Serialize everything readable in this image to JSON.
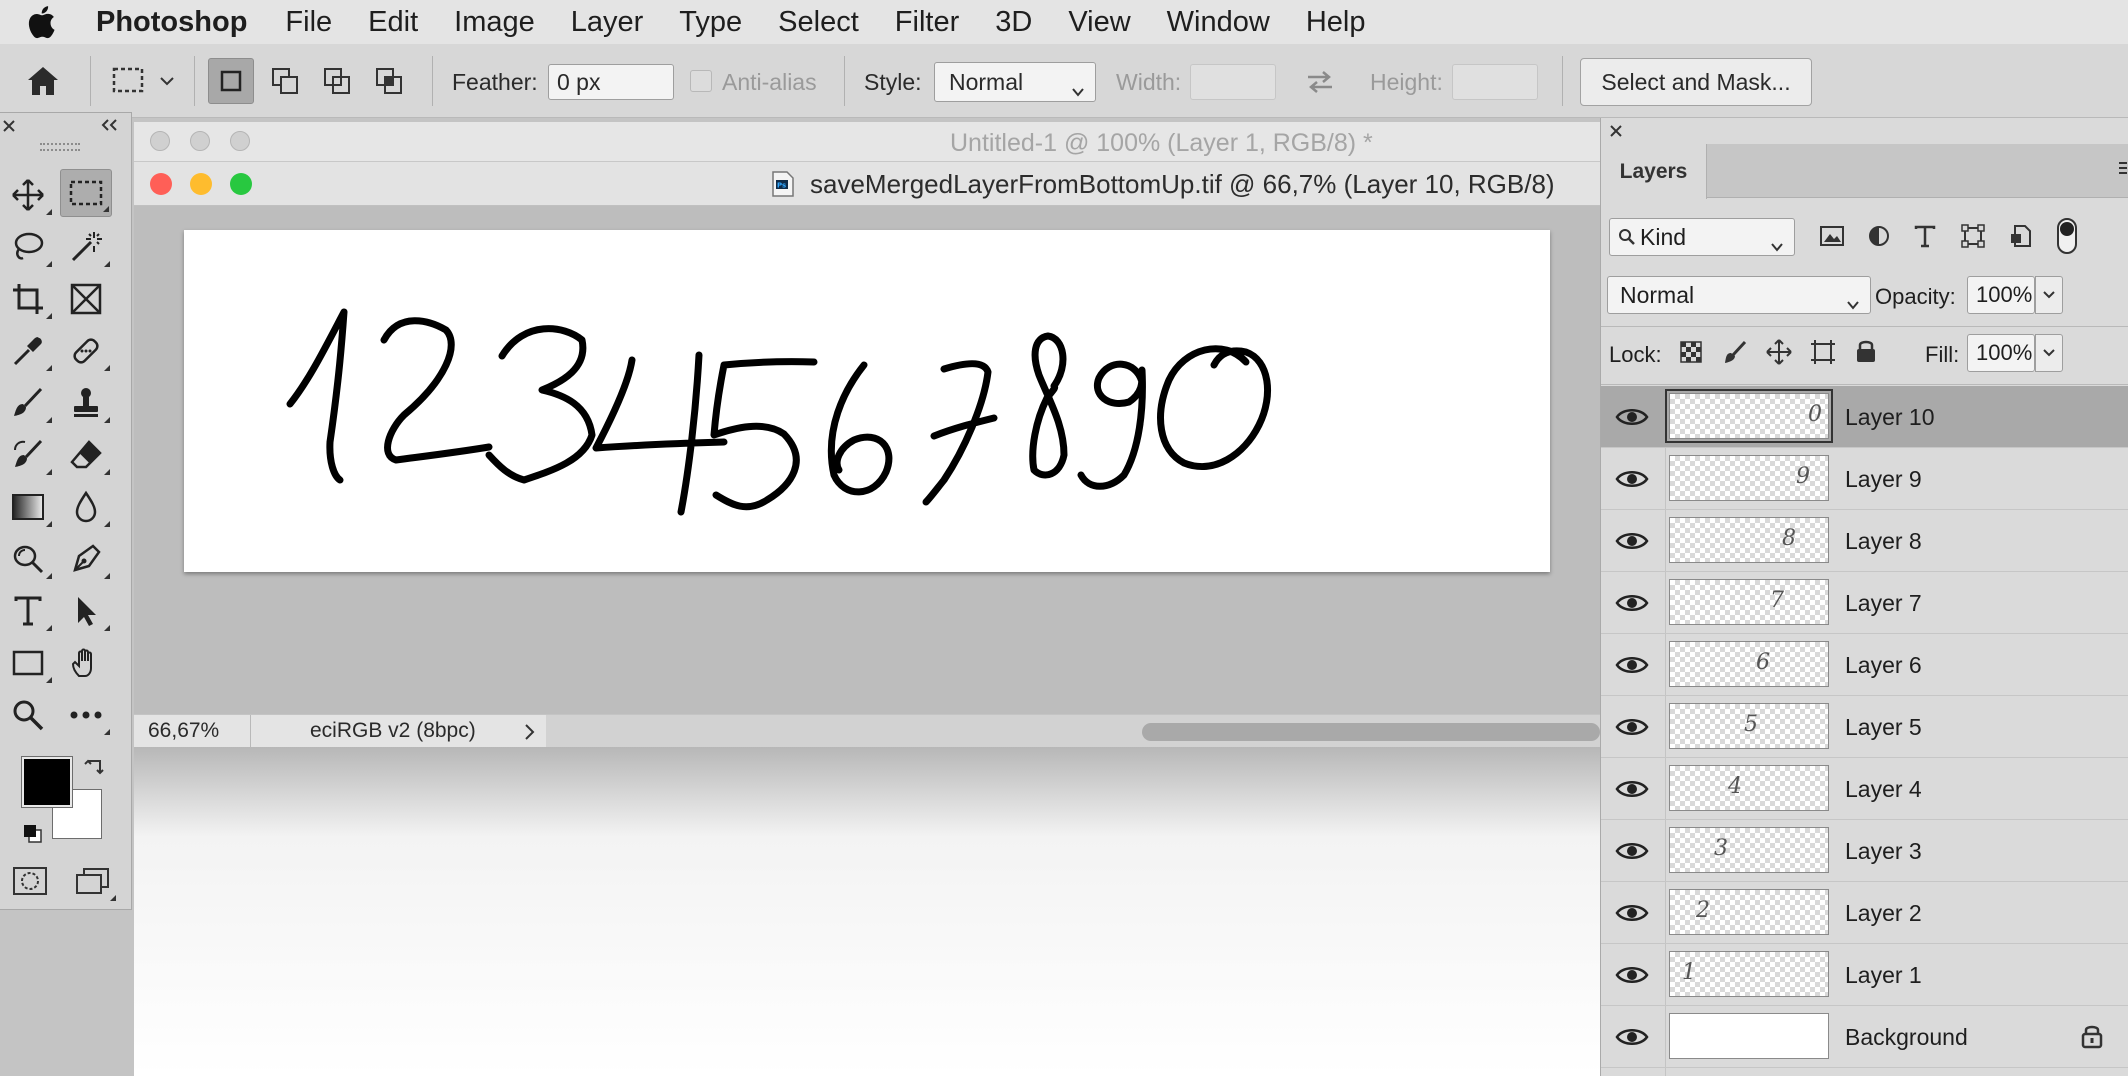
{
  "menubar": {
    "app_name": "Photoshop",
    "items": [
      "File",
      "Edit",
      "Image",
      "Layer",
      "Type",
      "Select",
      "Filter",
      "3D",
      "View",
      "Window",
      "Help"
    ]
  },
  "options": {
    "feather_label": "Feather:",
    "feather_value": "0 px",
    "antialias_label": "Anti-alias",
    "style_label": "Style:",
    "style_value": "Normal",
    "width_label": "Width:",
    "height_label": "Height:",
    "select_mask_label": "Select and Mask..."
  },
  "documents": {
    "back_title": "Untitled-1 @ 100% (Layer 1, RGB/8) *",
    "front_title": "saveMergedLayerFromBottomUp.tif @ 66,7% (Layer 10, RGB/8)",
    "zoom": "66,67%",
    "color_profile": "eciRGB v2 (8bpc)",
    "canvas_digits": "1234567890"
  },
  "layers_panel": {
    "tab_label": "Layers",
    "filter_kind": "Kind",
    "blend_mode": "Normal",
    "opacity_label": "Opacity:",
    "opacity_value": "100%",
    "lock_label": "Lock:",
    "fill_label": "Fill:",
    "fill_value": "100%",
    "layers": [
      {
        "name": "Layer 10",
        "digit": "0"
      },
      {
        "name": "Layer 9",
        "digit": "9"
      },
      {
        "name": "Layer 8",
        "digit": "8"
      },
      {
        "name": "Layer 7",
        "digit": "7"
      },
      {
        "name": "Layer 6",
        "digit": "6"
      },
      {
        "name": "Layer 5",
        "digit": "5"
      },
      {
        "name": "Layer 4",
        "digit": "4"
      },
      {
        "name": "Layer 3",
        "digit": "3"
      },
      {
        "name": "Layer 2",
        "digit": "2"
      },
      {
        "name": "Layer 1",
        "digit": "1"
      },
      {
        "name": "Background",
        "digit": ""
      }
    ]
  },
  "colors": {
    "foreground": "#000000",
    "background": "#ffffff",
    "close": "#ff5f57",
    "minimize": "#febc2e",
    "zoom": "#28c840",
    "selected_layer": "#a9a9a9"
  }
}
